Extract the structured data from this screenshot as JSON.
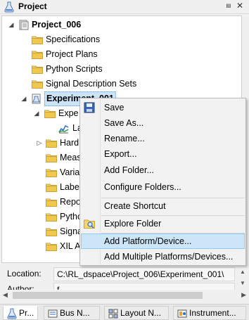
{
  "panel": {
    "title": "Project",
    "pin_glyph": "⩏",
    "close_glyph": "✕"
  },
  "tree": {
    "root": "Project_006",
    "items": [
      {
        "label": "Specifications"
      },
      {
        "label": "Project Plans"
      },
      {
        "label": "Python Scripts"
      },
      {
        "label": "Signal Description Sets"
      }
    ],
    "experiment": "Experiment_001",
    "experiment_children": [
      {
        "label": "Expe"
      },
      {
        "label": "La"
      },
      {
        "label": "Hard"
      },
      {
        "label": "Meas"
      },
      {
        "label": "Varia"
      },
      {
        "label": "Labe"
      },
      {
        "label": "Repo"
      },
      {
        "label": "Pytho"
      },
      {
        "label": "Signa"
      },
      {
        "label": "XIL A"
      }
    ]
  },
  "context_menu": {
    "items": [
      {
        "label": "Save",
        "icon": "floppy-disk-icon"
      },
      {
        "label": "Save As..."
      },
      {
        "label": "Rename..."
      },
      {
        "label": "Export..."
      },
      {
        "label": "Add Folder..."
      },
      {
        "label": "Configure Folders..."
      },
      {
        "label": "Create Shortcut"
      },
      {
        "label": "Explore Folder",
        "icon": "explore-folder-icon"
      },
      {
        "label": "Add Platform/Device...",
        "highlighted": true
      },
      {
        "label": "Add Multiple Platforms/Devices..."
      }
    ]
  },
  "properties": {
    "location_label": "Location:",
    "location_value": "C:\\RL_dspace\\Project_006\\Experiment_001\\",
    "author_label": "Author:",
    "author_value": "f"
  },
  "tabs": [
    {
      "label": "Pr...",
      "icon": "project-flask-icon",
      "active": true
    },
    {
      "label": "Bus N...",
      "icon": "bus-navigator-icon"
    },
    {
      "label": "Layout N...",
      "icon": "layout-navigator-icon"
    },
    {
      "label": "Instrument...",
      "icon": "instrument-selector-icon"
    }
  ],
  "colors": {
    "selection": "#cce4f7",
    "menu_hover": "#cde6f7",
    "folder": "#e8c25a"
  }
}
